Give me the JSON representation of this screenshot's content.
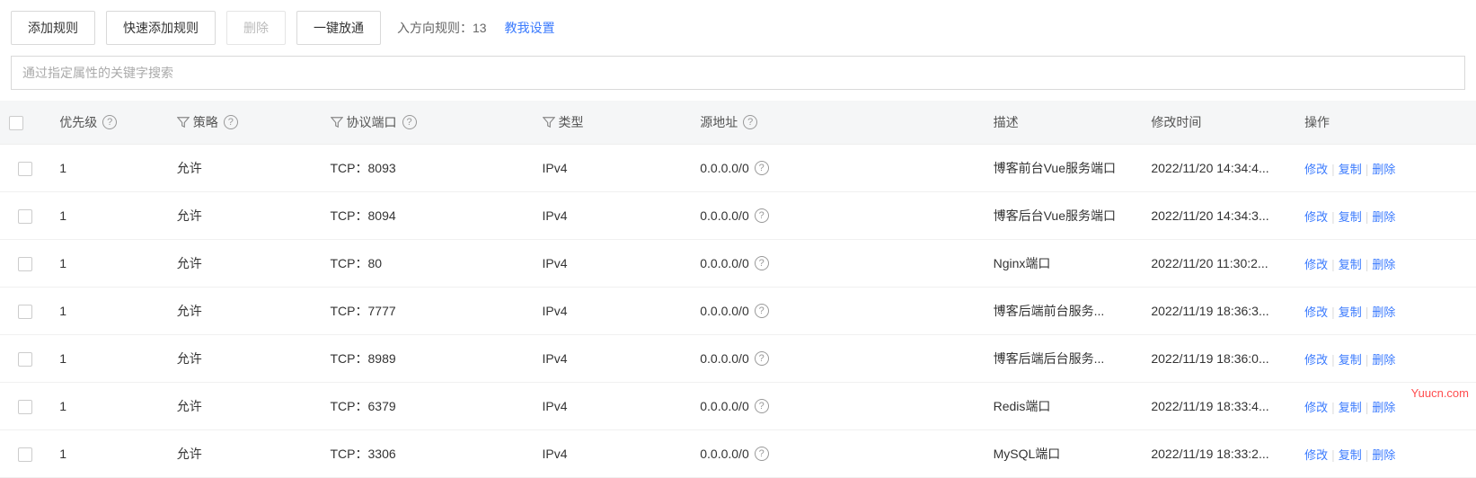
{
  "toolbar": {
    "add_rule": "添加规则",
    "quick_add_rule": "快速添加规则",
    "delete": "删除",
    "one_click_allow": "一键放通",
    "inbound_label": "入方向规则：",
    "inbound_count": "13",
    "guide_link": "教我设置"
  },
  "search": {
    "placeholder": "通过指定属性的关键字搜索"
  },
  "columns": {
    "priority": "优先级",
    "policy": "策略",
    "protocol": "协议端口",
    "type": "类型",
    "source": "源地址",
    "desc": "描述",
    "time": "修改时间",
    "action": "操作"
  },
  "actions": {
    "modify": "修改",
    "copy": "复制",
    "delete": "删除"
  },
  "rows": [
    {
      "priority": "1",
      "policy": "允许",
      "protocol": "TCP：8093",
      "type": "IPv4",
      "source": "0.0.0.0/0",
      "desc": "博客前台Vue服务端口",
      "time": "2022/11/20 14:34:4..."
    },
    {
      "priority": "1",
      "policy": "允许",
      "protocol": "TCP：8094",
      "type": "IPv4",
      "source": "0.0.0.0/0",
      "desc": "博客后台Vue服务端口",
      "time": "2022/11/20 14:34:3..."
    },
    {
      "priority": "1",
      "policy": "允许",
      "protocol": "TCP：80",
      "type": "IPv4",
      "source": "0.0.0.0/0",
      "desc": "Nginx端口",
      "time": "2022/11/20 11:30:2..."
    },
    {
      "priority": "1",
      "policy": "允许",
      "protocol": "TCP：7777",
      "type": "IPv4",
      "source": "0.0.0.0/0",
      "desc": "博客后端前台服务...",
      "time": "2022/11/19 18:36:3..."
    },
    {
      "priority": "1",
      "policy": "允许",
      "protocol": "TCP：8989",
      "type": "IPv4",
      "source": "0.0.0.0/0",
      "desc": "博客后端后台服务...",
      "time": "2022/11/19 18:36:0..."
    },
    {
      "priority": "1",
      "policy": "允许",
      "protocol": "TCP：6379",
      "type": "IPv4",
      "source": "0.0.0.0/0",
      "desc": "Redis端口",
      "time": "2022/11/19 18:33:4..."
    },
    {
      "priority": "1",
      "policy": "允许",
      "protocol": "TCP：3306",
      "type": "IPv4",
      "source": "0.0.0.0/0",
      "desc": "MySQL端口",
      "time": "2022/11/19 18:33:2..."
    }
  ],
  "watermark": "Yuucn.com"
}
